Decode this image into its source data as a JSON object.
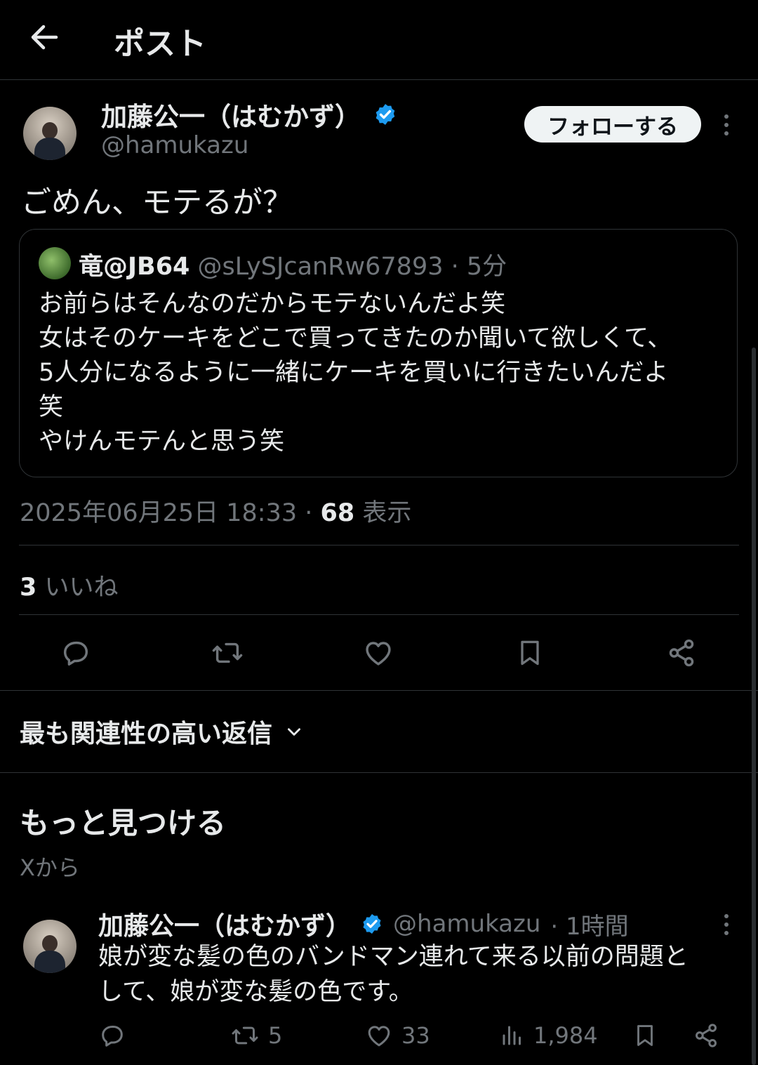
{
  "header": {
    "title": "ポスト"
  },
  "post": {
    "display_name": "加藤公一（はむかず）",
    "handle": "@hamukazu",
    "follow_label": "フォローする",
    "text": "ごめん、モテるが？",
    "quote": {
      "display_name": "竜@JB64",
      "handle": "@sLySJcanRw67893",
      "time": "· 5分",
      "lines": [
        "お前らはそんなのだからモテないんだよ笑",
        "女はそのケーキをどこで買ってきたのか聞いて欲しくて、",
        "5人分になるように一緒にケーキを買いに行きたいんだよ",
        "笑",
        "やけんモテんと思う笑"
      ]
    },
    "timestamp": "2025年06月25日 18:33 ·",
    "views_count": "68",
    "views_label": "表示",
    "likes_count": "3",
    "likes_label": "いいね",
    "actions": [
      "reply-icon",
      "repost-icon",
      "like-icon",
      "bookmark-icon",
      "share-icon"
    ]
  },
  "replies_sort": {
    "label": "最も関連性の高い返信"
  },
  "discover": {
    "title": "もっと見つける",
    "subtitle": "Xから"
  },
  "related_post": {
    "display_name": "加藤公一（はむかず）",
    "handle": "@hamukazu",
    "time": "· 1時間",
    "text_line1": "娘が変な髪の色のバンドマン連れて来る以前の問題と",
    "text_line2": "して、娘が変な髪の色です。",
    "retweets": "5",
    "likes": "33",
    "views": "1,984"
  },
  "colors": {
    "background": "#000000",
    "text": "#e7e9ea",
    "muted": "#71767b",
    "verified": "#1d9bf0",
    "divider": "#2f3336"
  }
}
